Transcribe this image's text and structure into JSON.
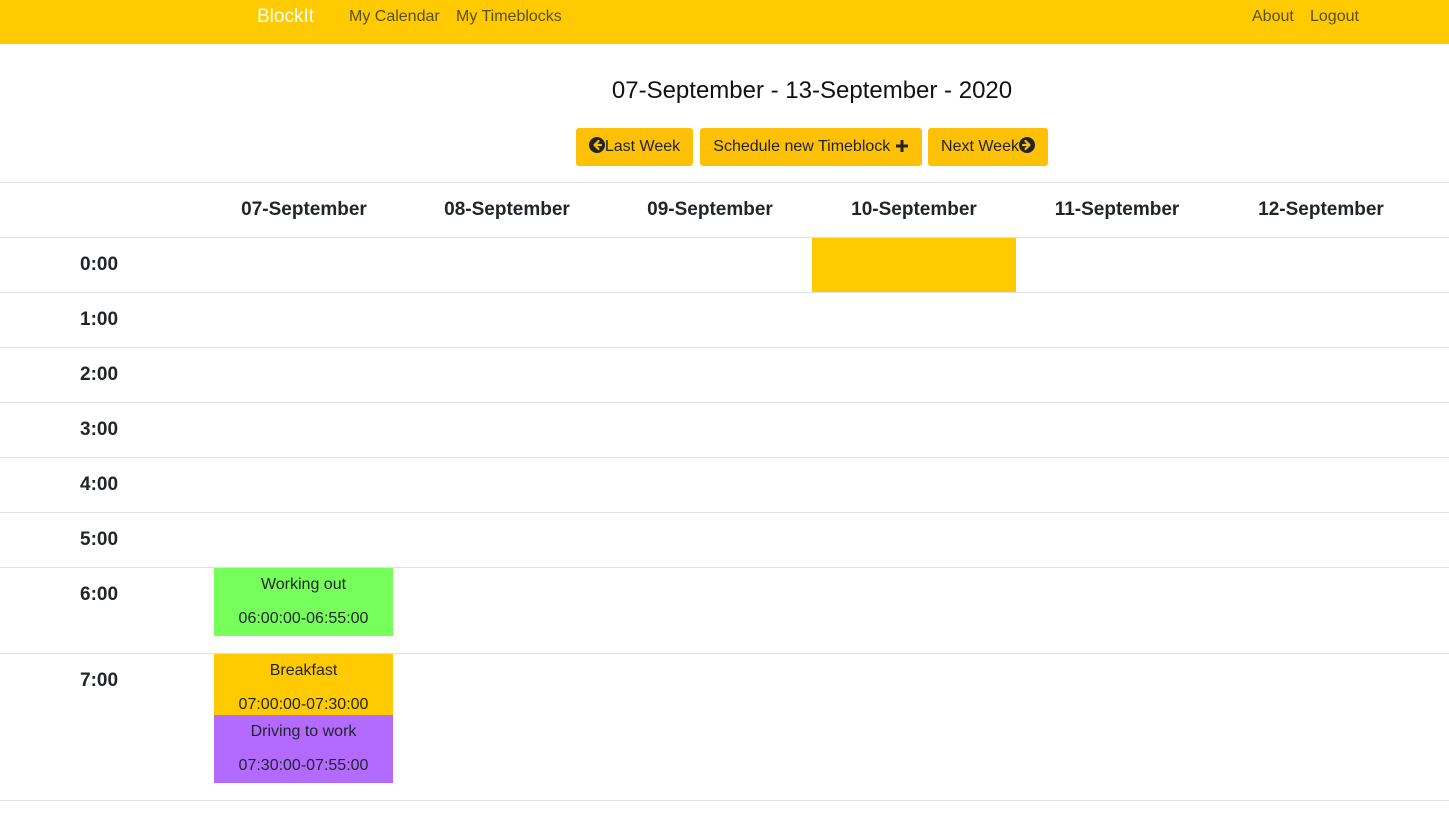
{
  "navbar": {
    "brand": "BlockIt",
    "links": [
      "My Calendar",
      "My Timeblocks"
    ],
    "right_links": [
      "About",
      "Logout"
    ],
    "color": "#ffcb00"
  },
  "week_title": "07-September - 13-September - 2020",
  "buttons": {
    "last_week": "Last Week",
    "schedule": "Schedule new Timeblock",
    "next_week": "Next Week",
    "color": "#ffc107"
  },
  "days": [
    "07-September",
    "08-September",
    "09-September",
    "10-September",
    "11-September",
    "12-September"
  ],
  "hours": [
    "0:00",
    "1:00",
    "2:00",
    "3:00",
    "4:00",
    "5:00",
    "6:00",
    "7:00"
  ],
  "timeblocks": [
    {
      "title": "",
      "time": "",
      "color": "#ffcb00"
    },
    {
      "title": "Working out",
      "time": "06:00:00-06:55:00",
      "color": "#76ff5a"
    },
    {
      "title": "Breakfast",
      "time": "07:00:00-07:30:00",
      "color": "#ffcb00"
    },
    {
      "title": "Driving to work",
      "time": "07:30:00-07:55:00",
      "color": "#b36bff"
    }
  ]
}
